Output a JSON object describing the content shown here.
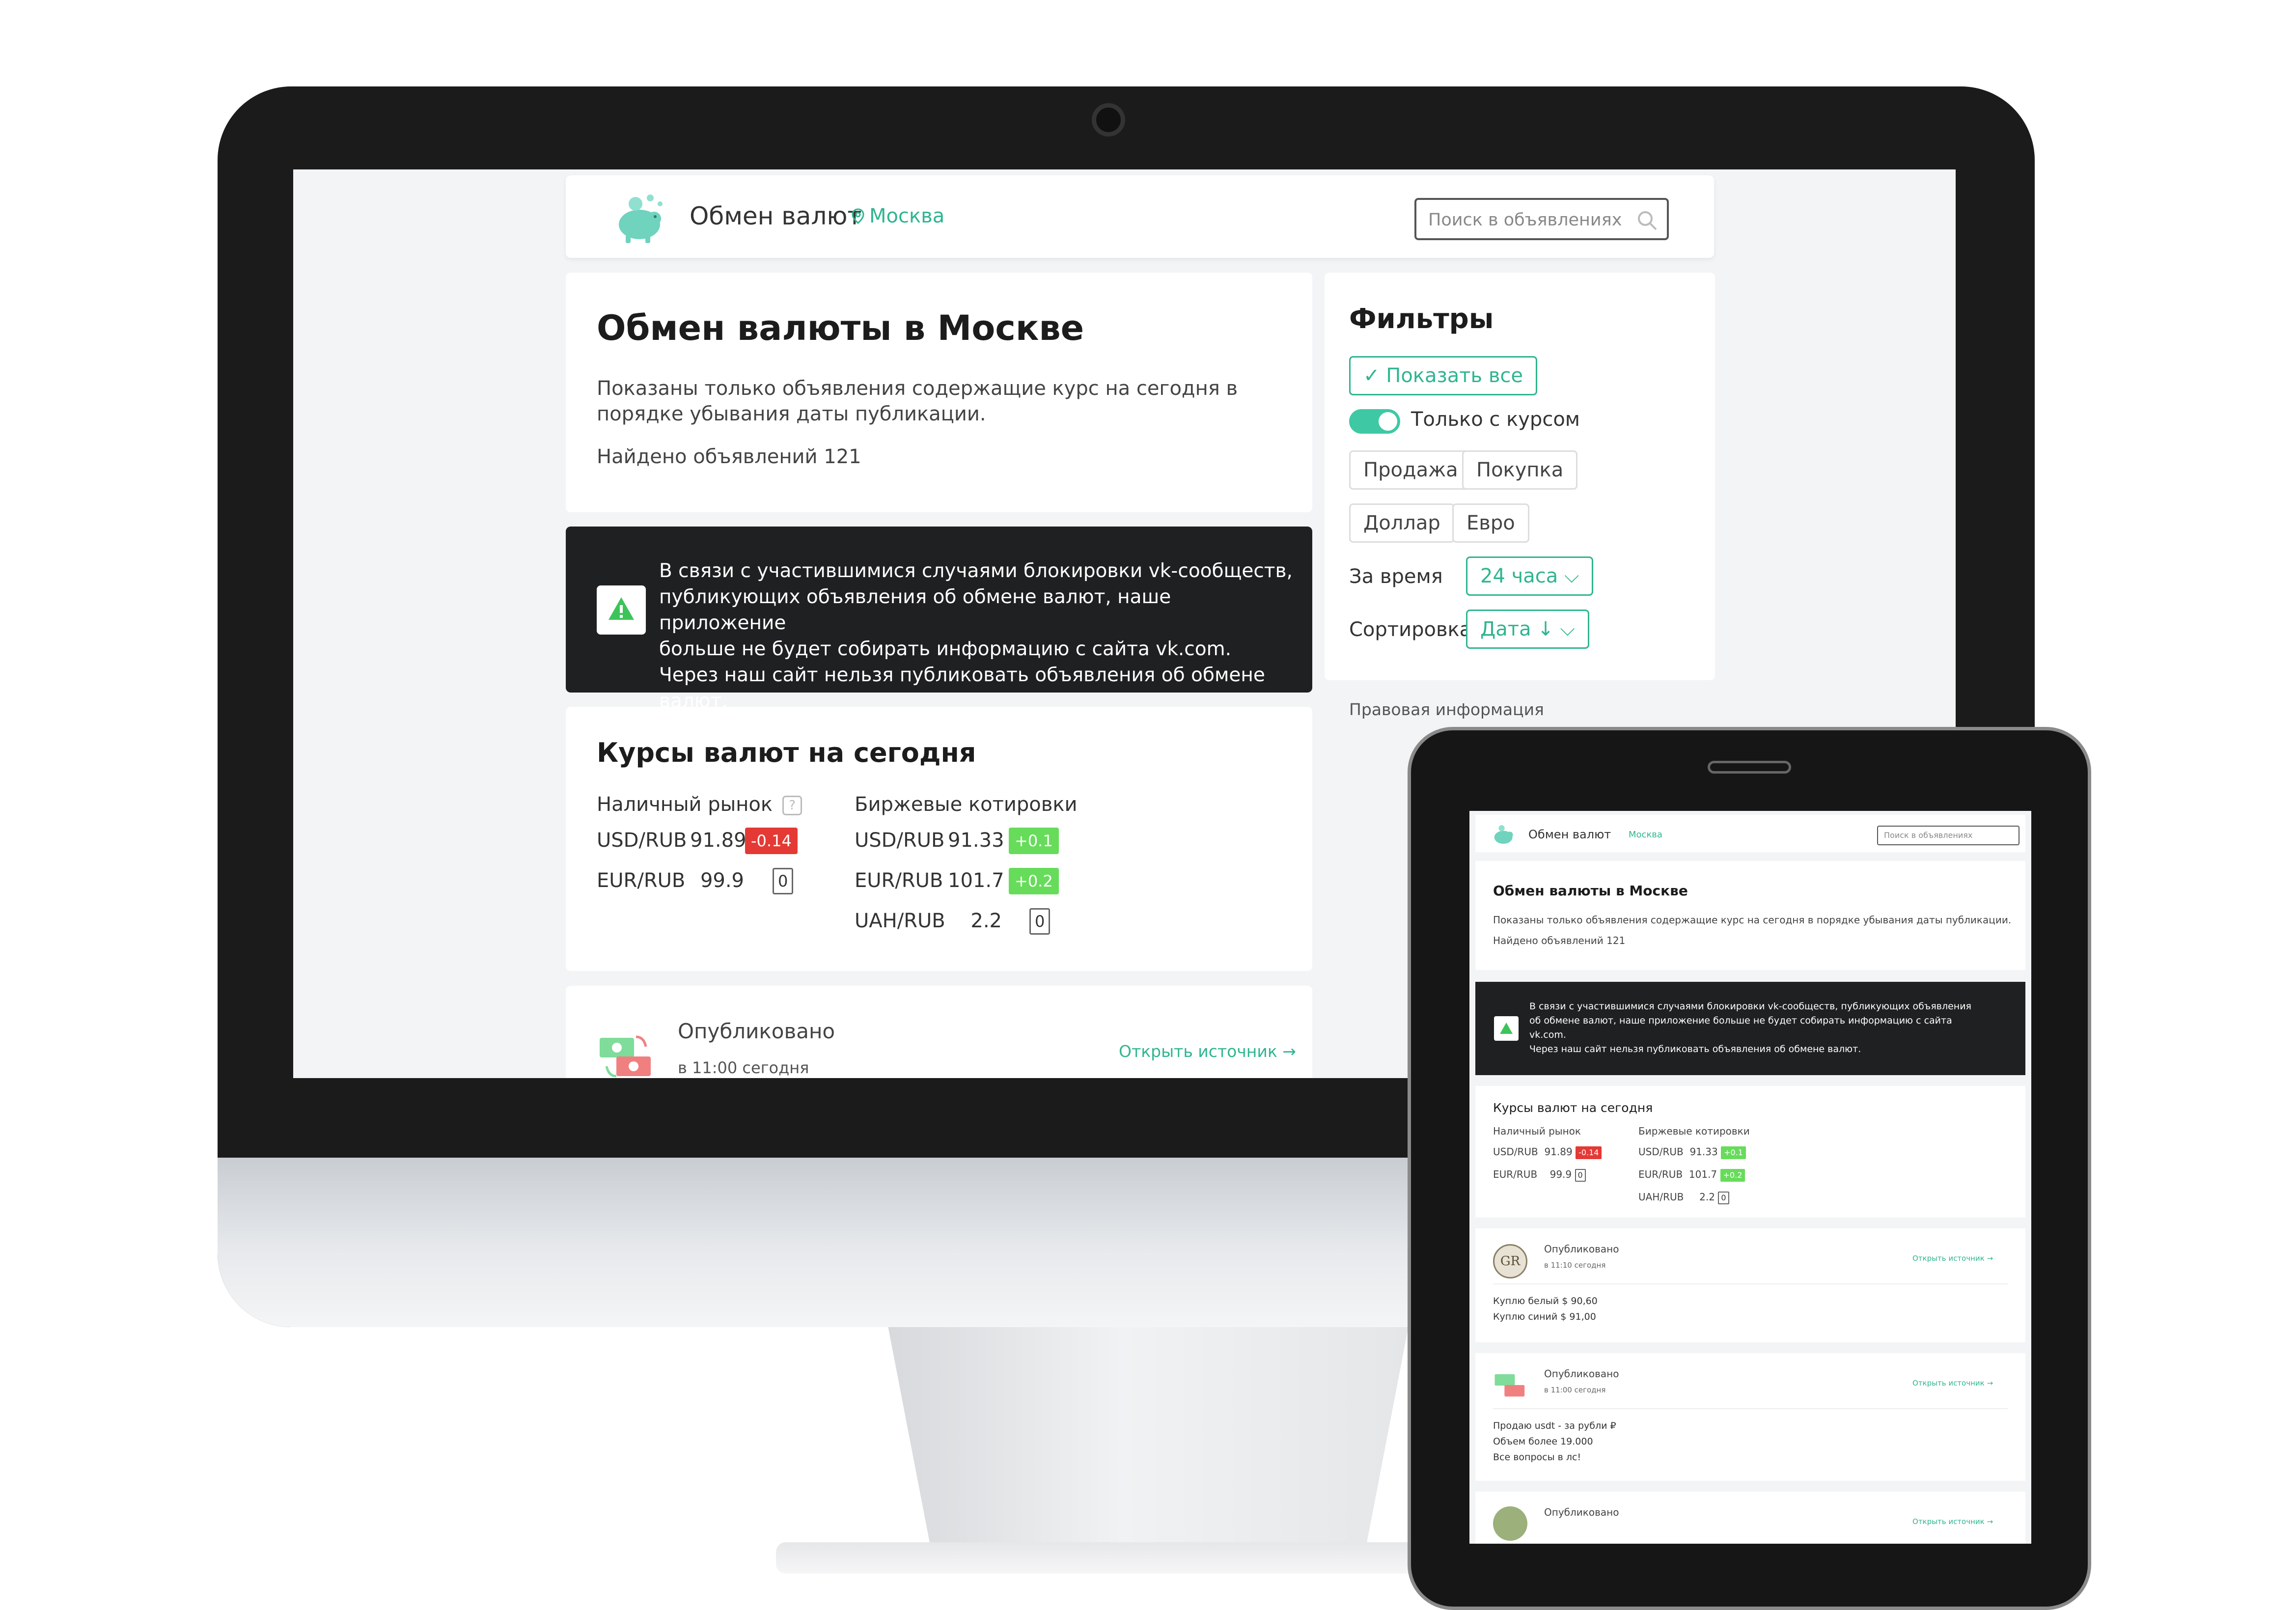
{
  "site": {
    "app_title": "Обмен валют",
    "city": "Москва",
    "search_placeholder": "Поиск в объявлениях"
  },
  "intro": {
    "title": "Обмен валюты в Москве",
    "description": "Показаны только объявления содержащие курс на сегодня в порядке убывания даты публикации.",
    "count": "Найдено объявлений 121"
  },
  "notice": {
    "lines": [
      "В связи с участившимися случаями блокировки vk-сообществ,",
      "публикующих объявления об обмене валют, наше приложение",
      "больше не будет собирать информацию с сайта vk.com.",
      "Через наш сайт нельзя публиковать объявления об обмене валют."
    ]
  },
  "rates": {
    "title": "Курсы валют на сегодня",
    "cash_title": "Наличный рынок",
    "help_icon": "?",
    "exchange_title": "Биржевые котировки",
    "cash": [
      {
        "pair": "USD/RUB",
        "value": "91.89",
        "change": "-0.14",
        "dir": "neg"
      },
      {
        "pair": "EUR/RUB",
        "value": "99.9",
        "change": "0",
        "dir": "zero"
      }
    ],
    "exchange": [
      {
        "pair": "USD/RUB",
        "value": "91.33",
        "change": "+0.1",
        "dir": "pos"
      },
      {
        "pair": "EUR/RUB",
        "value": "101.7",
        "change": "+0.2",
        "dir": "pos"
      },
      {
        "pair": "UAH/RUB",
        "value": "2.2",
        "change": "0",
        "dir": "zero"
      }
    ]
  },
  "post": {
    "status": "Опубликовано",
    "time": "в 11:00 сегодня",
    "link": "Открыть источник",
    "arrow": "→"
  },
  "filters": {
    "title": "Фильтры",
    "show_all": "Показать все",
    "check": "✓",
    "only_with_rate": "Только с курсом",
    "sell": "Продажа",
    "buy": "Покупка",
    "dollar": "Доллар",
    "euro": "Евро",
    "period_label": "За время",
    "period_value": "24 часа",
    "sort_label": "Сортировка",
    "sort_value": "Дата ↓",
    "chevron": "⌵"
  },
  "legal": "Правовая информация",
  "tablet": {
    "notice_lines": [
      "В связи с участившимися случаями блокировки vk-сообществ, публикующих объявления",
      "об обмене валют, наше приложение больше не будет собирать информацию с сайта",
      "vk.com.",
      "Через наш сайт нельзя публиковать объявления об обмене валют."
    ],
    "posts": [
      {
        "avatar": "GR",
        "status": "Опубликовано",
        "time": "в 11:10 сегодня",
        "link": "Открыть источник →",
        "body": [
          "Куплю белый $ 90,60",
          "Куплю синий $ 91,00"
        ]
      },
      {
        "avatar": "",
        "status": "Опубликовано",
        "time": "в 11:00 сегодня",
        "link": "Открыть источник →",
        "body": [
          "Продаю usdt - за рубли ₽",
          "Объем более 19.000",
          "Все вопросы в лс!"
        ]
      },
      {
        "avatar": "",
        "status": "Опубликовано",
        "time": "",
        "link": "Открыть источник →",
        "body": []
      }
    ]
  },
  "colors": {
    "accent": "#2fb590",
    "negative": "#e53935",
    "positive": "#67dc5b",
    "notice_bg": "#1f2021"
  }
}
